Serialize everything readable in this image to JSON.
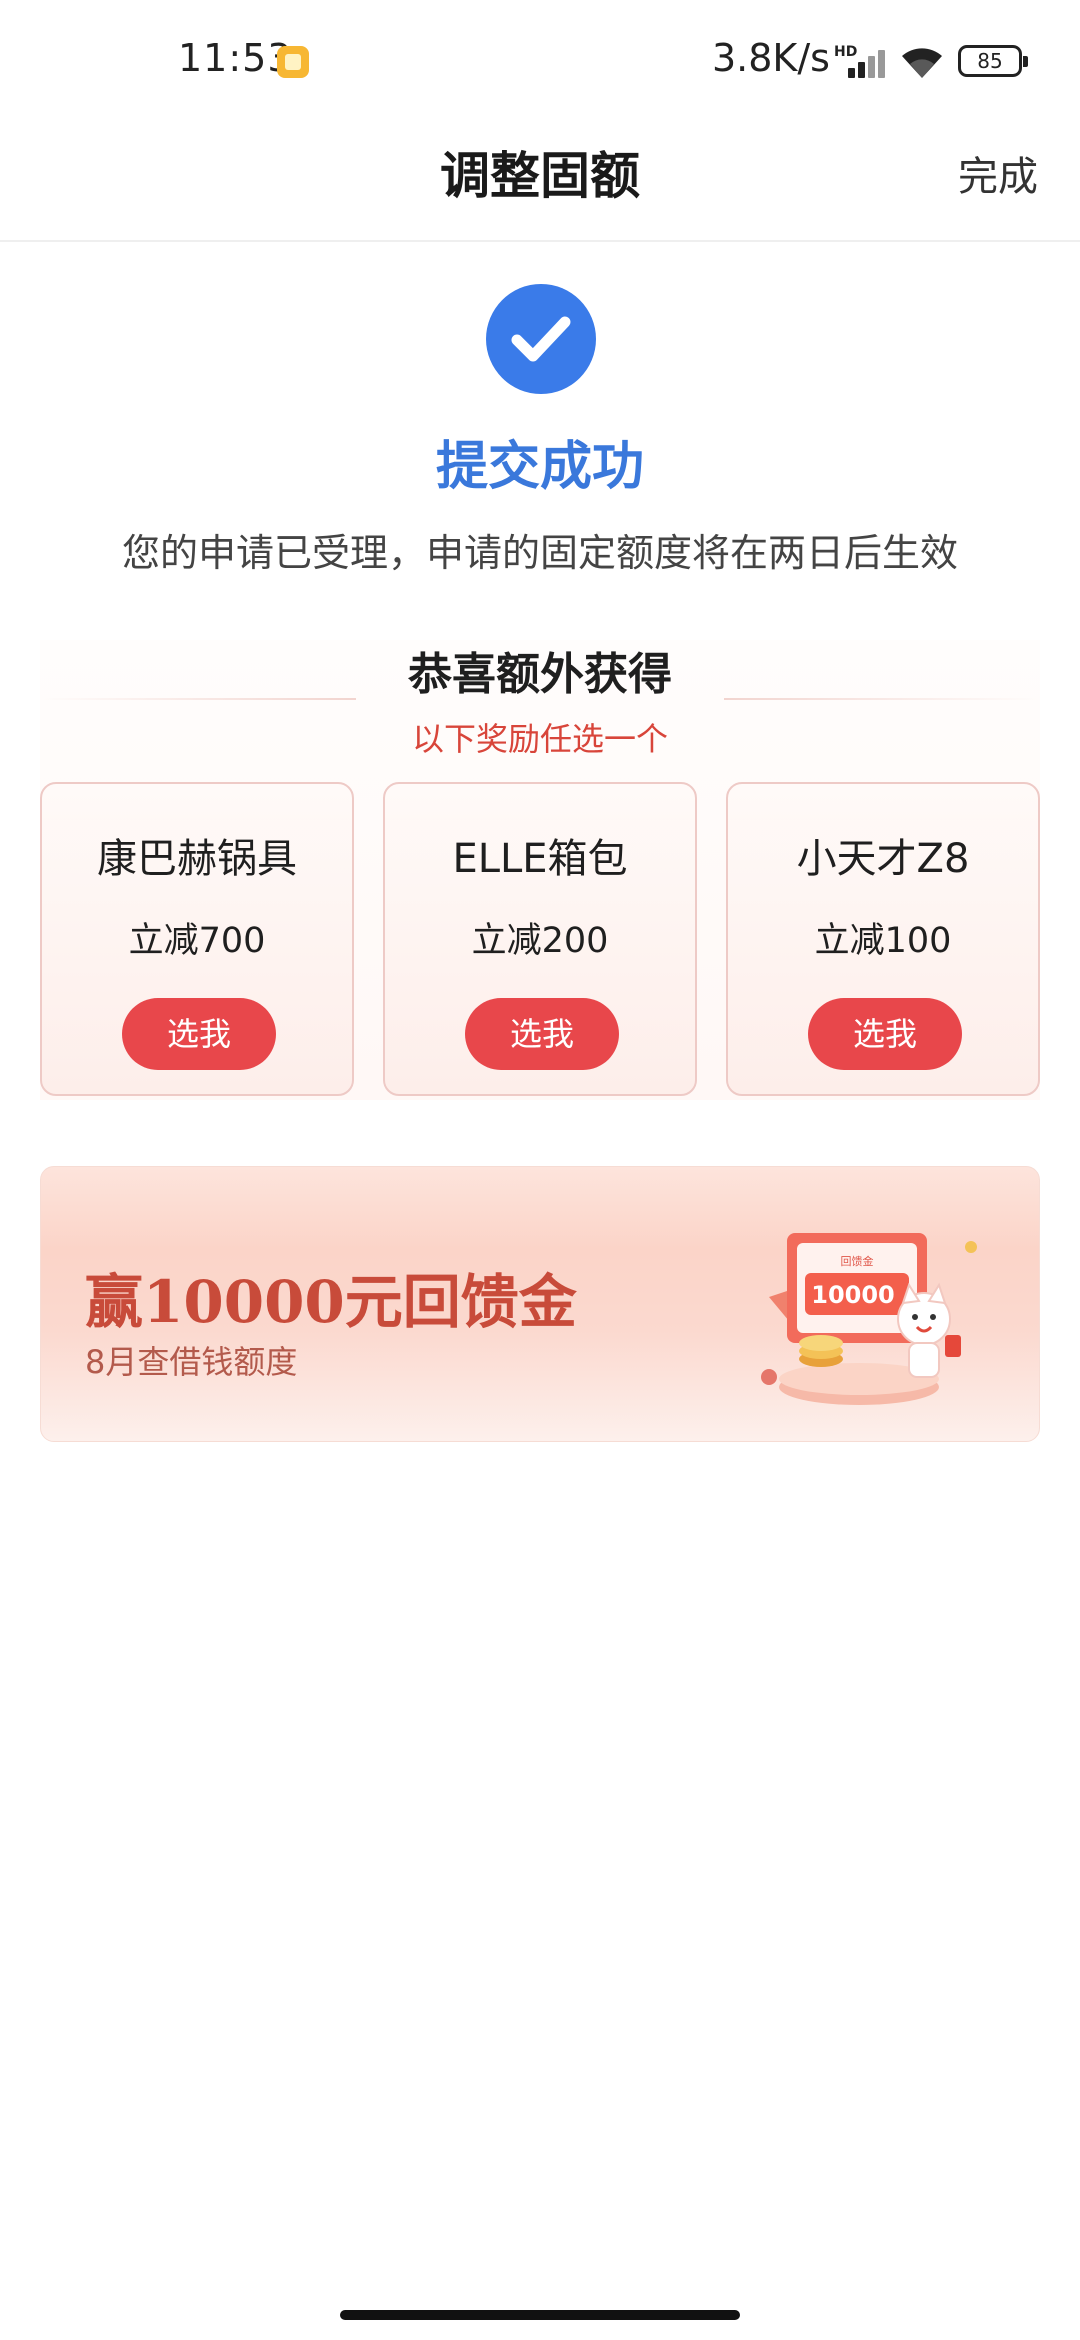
{
  "status_bar": {
    "time": "11:53",
    "network_speed": "3.8K/s",
    "network_type": "HD",
    "battery": "85"
  },
  "header": {
    "title": "调整固额",
    "done_label": "完成"
  },
  "result": {
    "title": "提交成功",
    "description": "您的申请已受理，申请的固定额度将在两日后生效",
    "accent_color": "#3a7be9"
  },
  "rewards": {
    "title": "恭喜额外获得",
    "subtitle": "以下奖励任选一个",
    "items": [
      {
        "name": "康巴赫锅具",
        "discount": "立减700",
        "button": "选我"
      },
      {
        "name": "ELLE箱包",
        "discount": "立减200",
        "button": "选我"
      },
      {
        "name": "小天才Z8",
        "discount": "立减100",
        "button": "选我"
      }
    ],
    "button_color": "#e8474b"
  },
  "banner": {
    "title": "赢10000元回馈金",
    "subtitle": "8月查借钱额度",
    "ticket_amount": "10000",
    "ticket_label": "回馈金"
  }
}
